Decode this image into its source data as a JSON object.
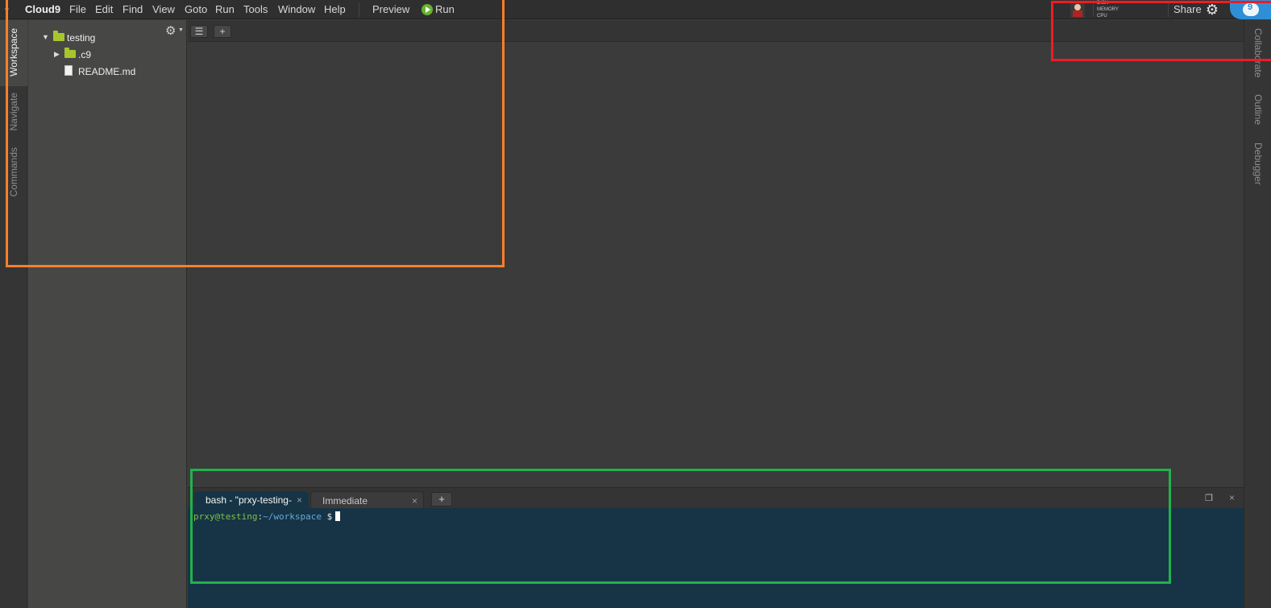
{
  "menubar": {
    "brand": "Cloud9",
    "items": [
      "File",
      "Edit",
      "Find",
      "View",
      "Goto",
      "Run",
      "Tools",
      "Window",
      "Help"
    ],
    "preview_label": "Preview",
    "run_label": "Run",
    "meters": [
      "DISK",
      "MEMORY",
      "CPU"
    ],
    "share_label": "Share",
    "notification_count": "9"
  },
  "left_tabs": [
    "Workspace",
    "Navigate",
    "Commands"
  ],
  "right_tabs": [
    "Collaborate",
    "Outline",
    "Debugger"
  ],
  "file_tree": {
    "root": "testing",
    "children": [
      ".c9",
      "README.md"
    ]
  },
  "editor": {
    "add_tab_label": "+"
  },
  "terminal": {
    "tabs": [
      "bash - \"prxy-testing-",
      "Immediate"
    ],
    "close_glyph": "×",
    "add_label": "+",
    "prompt_user_host": "prxy@testing",
    "prompt_sep": ":",
    "prompt_path": "~/workspace",
    "prompt_symbol": "$"
  },
  "annotations": {
    "colors": [
      "#ff7f27",
      "#ee1c24",
      "#22b14c"
    ]
  }
}
